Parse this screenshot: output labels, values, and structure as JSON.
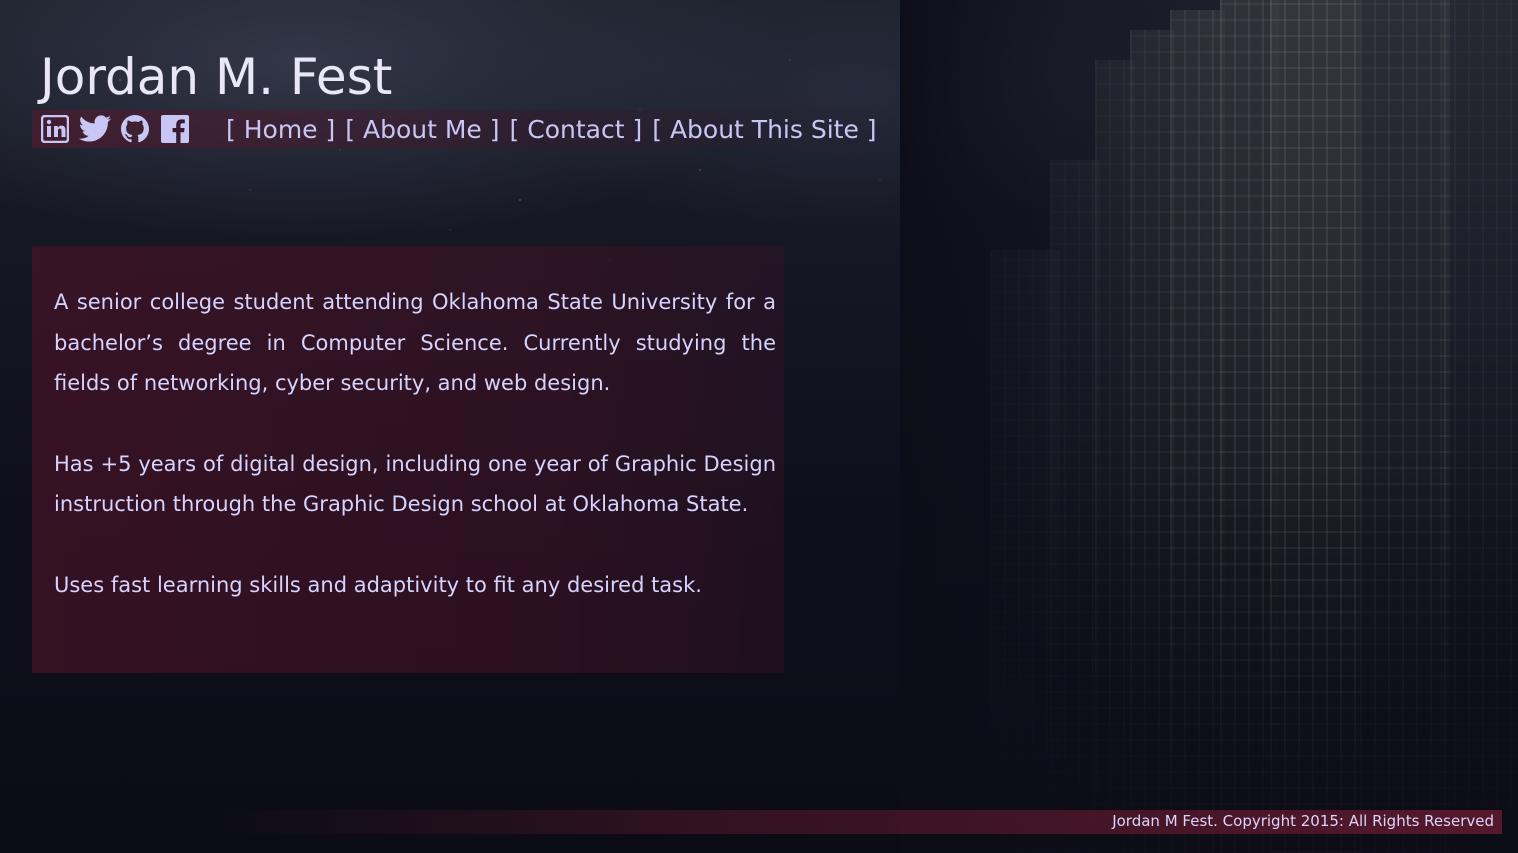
{
  "header": {
    "title": "Jordan M. Fest"
  },
  "social": [
    {
      "name": "linkedin-icon"
    },
    {
      "name": "twitter-icon"
    },
    {
      "name": "github-icon"
    },
    {
      "name": "facebook-icon"
    }
  ],
  "nav": {
    "bracket_open": "[",
    "bracket_close": "]",
    "items": [
      {
        "label": "Home"
      },
      {
        "label": "About Me"
      },
      {
        "label": "Contact"
      },
      {
        "label": "About This Site"
      }
    ]
  },
  "main": {
    "paragraphs": [
      "A senior college student attending Oklahoma State University for a bachelor’s degree in Computer Science. Currently studying the fields of networking, cyber security, and web design.",
      "Has +5 years of digital design, including one year of Graphic Design instruction through the Graphic Design school at Oklahoma State.",
      "Uses fast learning skills and adaptivity to fit any desired task."
    ]
  },
  "footer": {
    "copyright": "Jordan M Fest. Copyright 2015: All Rights Reserved"
  },
  "colors": {
    "text": "#d6d4ff",
    "accent_band": "#5a192d",
    "background": "#0d0d18"
  }
}
